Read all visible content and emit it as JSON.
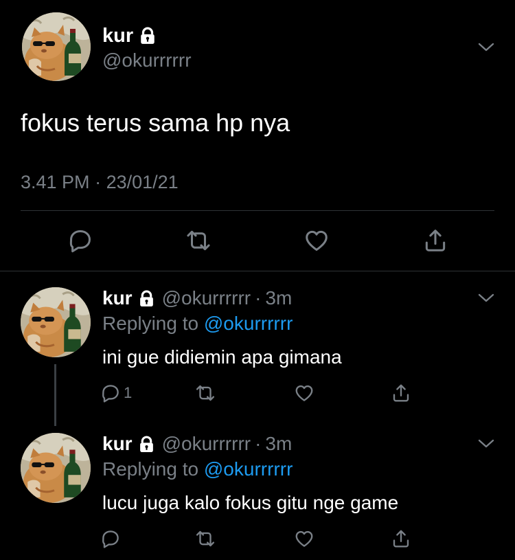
{
  "main_tweet": {
    "name": "kur",
    "handle": "@okurrrrrr",
    "text": "fokus terus sama hp nya",
    "time": "3.41 PM",
    "separator": "·",
    "date": "23/01/21"
  },
  "replies": [
    {
      "name": "kur",
      "handle": "@okurrrrrr",
      "dot": "·",
      "age": "3m",
      "replying_prefix": "Replying to",
      "replying_to": "@okurrrrrr",
      "text": "ini gue didiemin apa gimana",
      "reply_count": "1"
    },
    {
      "name": "kur",
      "handle": "@okurrrrrr",
      "dot": "·",
      "age": "3m",
      "replying_prefix": "Replying to",
      "replying_to": "@okurrrrrr",
      "text": "lucu juga kalo fokus gitu nge game",
      "reply_count": ""
    }
  ],
  "colors": {
    "background": "#000000",
    "muted": "#7a8087",
    "link": "#1d9bf0",
    "divider": "#2f3336"
  },
  "icons": [
    "lock-icon",
    "chevron-down-icon",
    "reply-icon",
    "retweet-icon",
    "like-icon",
    "share-icon"
  ]
}
